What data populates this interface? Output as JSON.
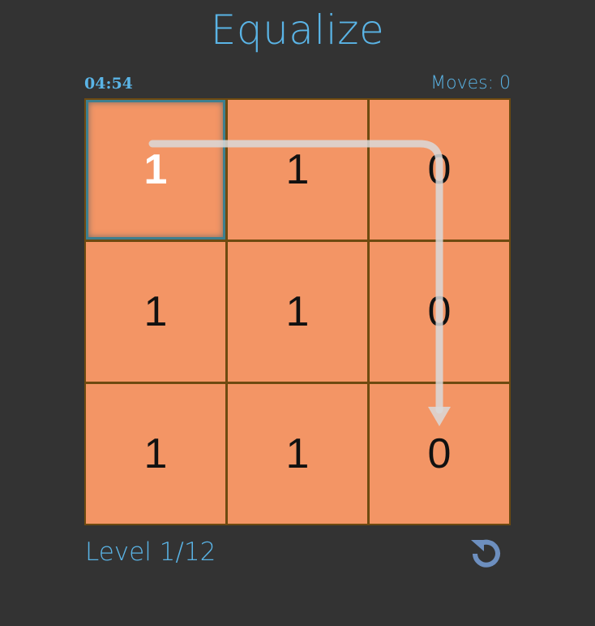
{
  "title": "Equalize",
  "timer": "04:54",
  "moves": "Moves: 0",
  "level": "Level 1/12",
  "grid": [
    [
      "1",
      "1",
      "0"
    ],
    [
      "1",
      "1",
      "0"
    ],
    [
      "1",
      "1",
      "0"
    ]
  ],
  "selected_cell": {
    "row": 0,
    "col": 0
  },
  "icons": {
    "reset": "reset-icon",
    "hint": "hint-arrow-icon"
  },
  "colors": {
    "accent": "#5ab4e6",
    "tile": "#f39565",
    "grid_line": "#6e4a10",
    "background": "#333333",
    "reset_icon": "#6d8fbf"
  }
}
